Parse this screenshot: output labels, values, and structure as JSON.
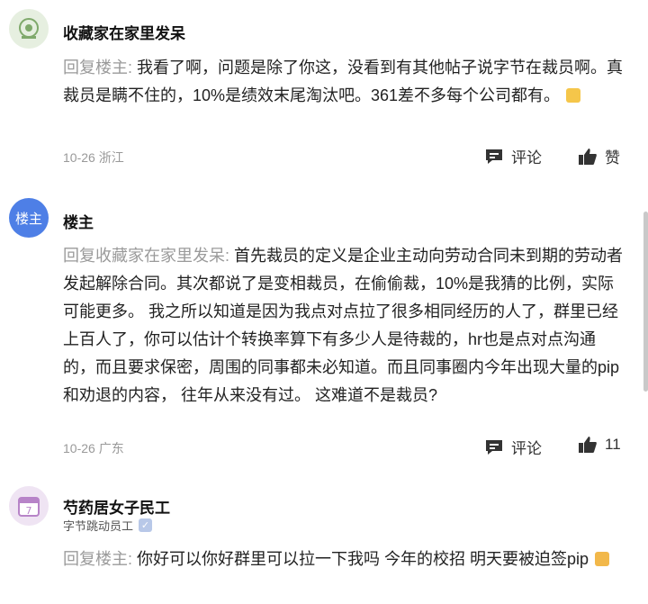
{
  "comments": [
    {
      "author": "收藏家在家里发呆",
      "reply_prefix": "回复楼主:",
      "text": "我看了啊，问题是除了你这，没看到有其他帖子说字节在裁员啊。真裁员是瞒不住的，10%是绩效末尾淘汰吧。361差不多每个公司都有。",
      "date": "10-26",
      "location": "浙江",
      "comment_label": "评论",
      "like_label": "赞"
    },
    {
      "author": "楼主",
      "avatar_text": "楼主",
      "reply_prefix": "回复收藏家在家里发呆:",
      "text": "首先裁员的定义是企业主动向劳动合同未到期的劳动者发起解除合同。其次都说了是变相裁员，在偷偷裁，10%是我猜的比例，实际可能更多。 我之所以知道是因为我点对点拉了很多相同经历的人了，群里已经上百人了，你可以估计个转换率算下有多少人是待裁的，hr也是点对点沟通的，而且要求保密，周围的同事都未必知道。而且同事圈内今年出现大量的pip和劝退的内容， 往年从来没有过。 这难道不是裁员?",
      "date": "10-26",
      "location": "广东",
      "comment_label": "评论",
      "like_label": "11"
    },
    {
      "author": "芍药居女子民工",
      "badge": "字节跳动员工",
      "reply_prefix": "回复楼主:",
      "text": "你好可以你好群里可以拉一下我吗 今年的校招 明天要被迫签pip",
      "avatar_digit": "7"
    }
  ],
  "colors": {
    "accent": "#4e7fe6",
    "muted": "#9a9a9a"
  }
}
